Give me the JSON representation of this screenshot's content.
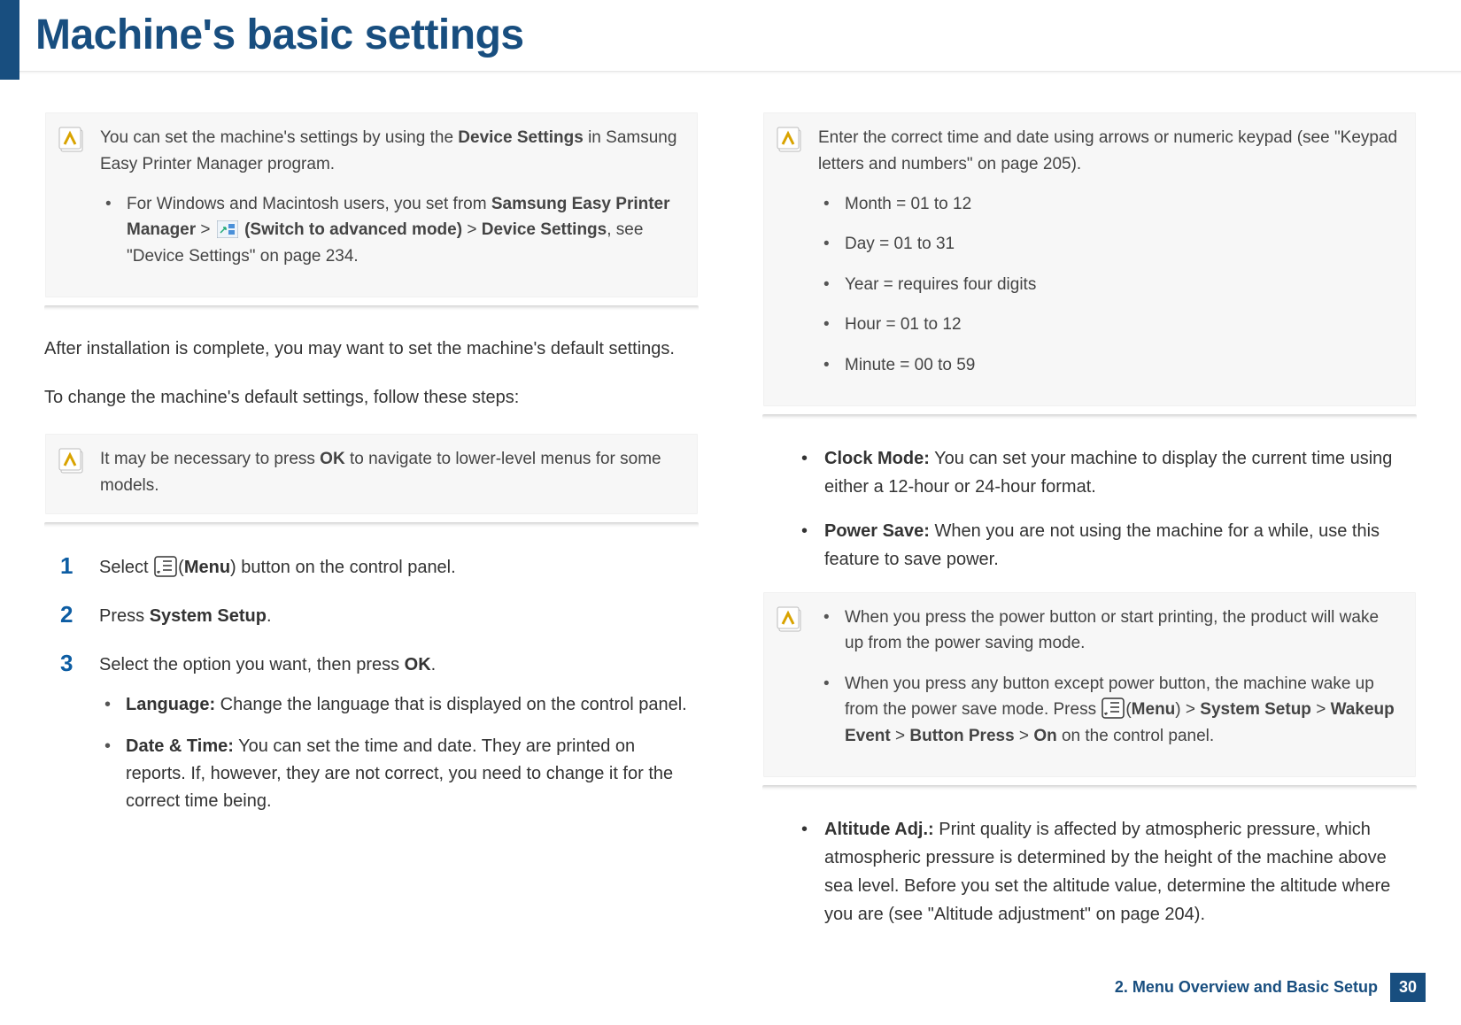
{
  "header": {
    "title": "Machine's basic settings"
  },
  "col1": {
    "note1": {
      "line1_pre": "You can set the machine's settings by using the ",
      "line1_bold": "Device Settings",
      "line1_post": " in Samsung Easy Printer Manager program.",
      "bullet_pre": "For Windows and Macintosh users, you set from ",
      "bullet_b1": "Samsung Easy Printer Manager",
      "bullet_gt1": " > ",
      "bullet_b2": "(Switch to advanced mode)",
      "bullet_gt2": " > ",
      "bullet_b3": "Device Settings",
      "bullet_post": ", see \"Device Settings\" on page 234."
    },
    "para1": "After installation is complete, you may want to set the machine's default settings.",
    "para2": "To change the machine's default settings, follow these steps:",
    "note2_pre": "It may be necessary to press ",
    "note2_bold": "OK",
    "note2_post": " to navigate to lower-level menus for some models.",
    "step1_pre": "Select ",
    "step1_menu_open": "(",
    "step1_menu": "Menu",
    "step1_menu_close": ")",
    "step1_post": " button on the control panel.",
    "step2_pre": "Press ",
    "step2_bold": "System Setup",
    "step2_post": ".",
    "step3_pre": "Select the option you want, then press ",
    "step3_bold": "OK",
    "step3_post": ".",
    "s3_opt1_b": "Language:",
    "s3_opt1_t": " Change the language that is displayed on the control panel.",
    "s3_opt2_b": "Date & Time:",
    "s3_opt2_t": " You can set the time and date. They are printed on reports. If, however, they are not correct, you need to change it for the correct time being."
  },
  "col2": {
    "note1_text": "Enter the correct time and date using arrows or numeric keypad (see \"Keypad letters and numbers\" on page 205).",
    "note1_items": {
      "i0": "Month = 01 to 12",
      "i1": "Day = 01 to 31",
      "i2": "Year = requires four digits",
      "i3": "Hour = 01 to 12",
      "i4": "Minute = 00 to 59"
    },
    "opt_clock_b": "Clock Mode:",
    "opt_clock_t": " You can set your machine to display the current time using either a 12-hour or 24-hour format.",
    "opt_power_b": "Power Save:",
    "opt_power_t": " When you are not using the machine for a while, use this feature to save power.",
    "note2_i0": "When you press the power button or start printing, the product will wake up from the power saving mode.",
    "note2_i1_pre": "When you press any button except power button, the machine wake up from the power save mode. Press ",
    "note2_i1_menu_open": "(",
    "note2_i1_menu": "Menu",
    "note2_i1_menu_close": ")",
    "note2_i1_gt1": " > ",
    "note2_i1_b1": "System Setup",
    "note2_i1_gt2": " > ",
    "note2_i1_b2": "Wakeup Event",
    "note2_i1_gt3": " > ",
    "note2_i1_b3": "Button Press",
    "note2_i1_gt4": " > ",
    "note2_i1_b4": "On",
    "note2_i1_post": " on the control panel.",
    "opt_alt_b": "Altitude Adj.:",
    "opt_alt_t": " Print quality is affected by atmospheric pressure, which atmospheric pressure is determined by the height of the machine above sea level. Before you set the altitude value, determine the altitude where you are (see \"Altitude adjustment\" on page 204)."
  },
  "footer": {
    "chapter": "2. Menu Overview and Basic Setup",
    "page": "30"
  }
}
